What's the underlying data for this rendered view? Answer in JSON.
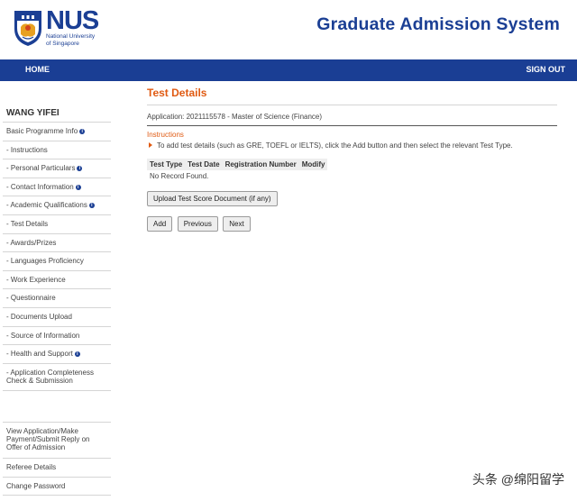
{
  "header": {
    "logo_abbr": "NUS",
    "logo_line1": "National University",
    "logo_line2": "of Singapore",
    "system_title": "Graduate Admission System"
  },
  "navbar": {
    "home": "HOME",
    "sign_out": "SIGN OUT"
  },
  "sidebar": {
    "user_name": "WANG YIFEI",
    "items": [
      {
        "label": "Basic Programme Info",
        "info": true
      },
      {
        "label": "- Instructions",
        "info": false
      },
      {
        "label": "- Personal Particulars",
        "info": true
      },
      {
        "label": "- Contact Information",
        "info": true
      },
      {
        "label": "- Academic Qualifications",
        "info": true
      },
      {
        "label": "- Test Details",
        "info": false
      },
      {
        "label": "- Awards/Prizes",
        "info": false
      },
      {
        "label": "- Languages Proficiency",
        "info": false
      },
      {
        "label": "- Work Experience",
        "info": false
      },
      {
        "label": "- Questionnaire",
        "info": false
      },
      {
        "label": "- Documents Upload",
        "info": false
      },
      {
        "label": "- Source of Information",
        "info": false
      },
      {
        "label": "- Health and Support",
        "info": true
      },
      {
        "label": "- Application Completeness Check & Submission",
        "info": false
      }
    ],
    "bottom_items": [
      {
        "label": "View Application/Make Payment/Submit Reply on Offer of Admission"
      },
      {
        "label": "Referee Details"
      },
      {
        "label": "Change Password"
      }
    ],
    "info_glyph": "i"
  },
  "main": {
    "title": "Test Details",
    "application_line": "Application: 2021115578 - Master of Science (Finance)",
    "instructions_title": "Instructions",
    "instructions_text": "To add test details (such as GRE, TOEFL or IELTS), click the Add button and then select the relevant Test Type.",
    "table": {
      "headers": [
        "Test Type",
        "Test Date",
        "Registration Number",
        "Modify"
      ],
      "empty_message": "No Record Found."
    },
    "upload_button": "Upload Test Score Document (if any)",
    "add_button": "Add",
    "previous_button": "Previous",
    "next_button": "Next"
  },
  "watermark": "头条 @绵阳留学",
  "colors": {
    "brand_blue": "#1b3f94",
    "accent_orange": "#e05a12"
  }
}
